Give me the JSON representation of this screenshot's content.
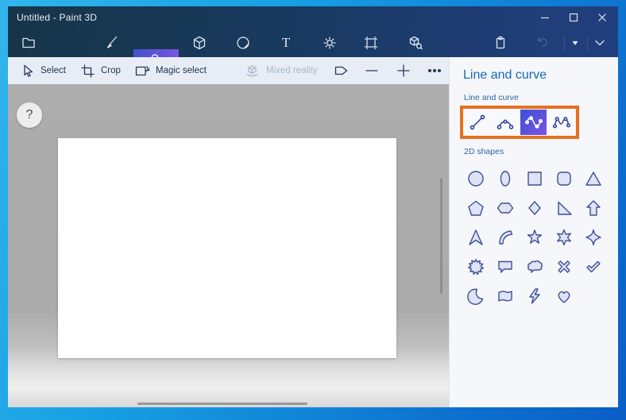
{
  "window": {
    "title": "Untitled - Paint 3D",
    "help_label": "?",
    "controls": [
      "minimize-icon",
      "maximize-icon",
      "close-icon"
    ]
  },
  "top_toolbar": {
    "selected_tab_label": "2D shapes",
    "text_icon_glyph": "T",
    "icons": [
      "menu-icon",
      "brush-icon",
      "2d-shapes-icon",
      "3d-shapes-icon",
      "stickers-icon",
      "text-icon",
      "effects-icon",
      "canvas-icon",
      "3d-library-icon",
      "paste-icon",
      "undo-icon",
      "history-dropdown-icon",
      "collapse-icon"
    ],
    "undo_disabled": true
  },
  "sub_toolbar": {
    "select_label": "Select",
    "crop_label": "Crop",
    "magic_select_label": "Magic select",
    "mixed_reality_label": "Mixed reality",
    "mixed_reality_disabled": true,
    "icons": [
      "cursor-icon",
      "crop-icon",
      "magic-select-icon",
      "mixed-reality-icon",
      "shape-outline-icon",
      "zoom-out-icon",
      "zoom-in-icon",
      "more-icon"
    ]
  },
  "panel": {
    "title": "Line and curve",
    "line_curve_label": "Line and curve",
    "shapes_label": "2D shapes",
    "tools": [
      "line",
      "curve",
      "s-curve",
      "double-curve"
    ],
    "selected_tool": "s-curve",
    "shapes": [
      "circle",
      "ellipse",
      "square",
      "rounded-square",
      "triangle",
      "pentagon",
      "hexagon",
      "diamond",
      "right-triangle",
      "block-arrow",
      "chevron-arrow",
      "curve-wedge",
      "star-5",
      "star-6",
      "star-4",
      "burst",
      "speech-bubble",
      "thought-bubble",
      "cross",
      "checkmark",
      "crescent",
      "banner",
      "lightning",
      "heart"
    ]
  },
  "colors": {
    "accent_gradient_start": "#3b50d4",
    "accent_gradient_end": "#7c54e4",
    "highlight_orange": "#e8701f",
    "panel_heading_blue": "#1769b5",
    "titlebar_navy": "#1b3a64",
    "workspace_gray": "#adadad"
  }
}
